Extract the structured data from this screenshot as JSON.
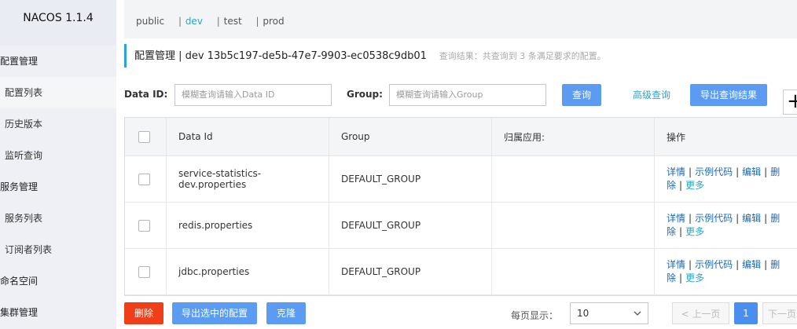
{
  "sidebar": {
    "brand": "NACOS 1.1.4",
    "groups": [
      {
        "label": "配置管理",
        "items": [
          "配置列表",
          "历史版本",
          "监听查询"
        ]
      },
      {
        "label": "服务管理",
        "items": [
          "服务列表",
          "订阅者列表"
        ]
      },
      {
        "label": "命名空间",
        "items": []
      },
      {
        "label": "集群管理",
        "items": []
      }
    ]
  },
  "namespaces": {
    "items": [
      "public",
      "dev",
      "test",
      "prod"
    ],
    "separator": "|",
    "selected": "dev"
  },
  "header": {
    "title": "配置管理 | dev 13b5c197-de5b-47e7-9903-ec0538c9db01",
    "hint": "查询结果：共查询到 3 条满足要求的配置。"
  },
  "search": {
    "dataid_label": "Data ID:",
    "dataid_placeholder": "模糊查询请输入Data ID",
    "group_label": "Group:",
    "group_placeholder": "模糊查询请输入Group",
    "query_button": "查询",
    "advanced_button": "高级查询",
    "export_button": "导出查询结果",
    "plus_label": "+"
  },
  "table": {
    "columns": [
      "Data Id",
      "Group",
      "归属应用:",
      "操作"
    ],
    "rows": [
      {
        "dataid": "service-statistics-dev.properties",
        "group": "DEFAULT_GROUP",
        "app": ""
      },
      {
        "dataid": "redis.properties",
        "group": "DEFAULT_GROUP",
        "app": ""
      },
      {
        "dataid": "jdbc.properties",
        "group": "DEFAULT_GROUP",
        "app": ""
      }
    ],
    "ops": {
      "detail": "详情",
      "sample": "示例代码",
      "edit": "编辑",
      "delete": "删",
      "delete_tail": "除",
      "more": "更多",
      "sep": "|"
    }
  },
  "footer": {
    "delete_button": "删除",
    "export_selected_button": "导出选中的配置",
    "clone_button": "克隆",
    "page_size_label": "每页显示：",
    "page_size_value": "10",
    "prev_label": "< 上一页",
    "current_page": "1",
    "next_label": "下一页"
  },
  "colors": {
    "accent": "#26a6c9",
    "primary_button": "#5b9bf1",
    "danger_button": "#ef3e18",
    "link": "#1a68b4"
  }
}
